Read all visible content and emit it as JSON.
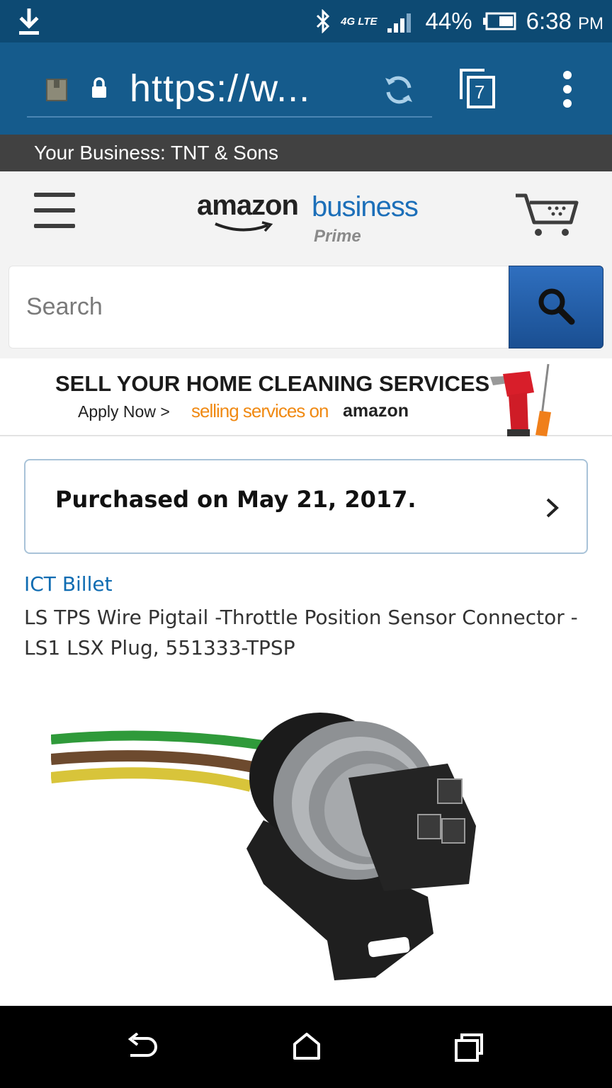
{
  "status_bar": {
    "network": "4G LTE",
    "battery": "44%",
    "time": "6:38",
    "time_suffix": "PM"
  },
  "browser": {
    "url": "https://w...",
    "tab_count": "7"
  },
  "business_bar": {
    "text": "Your Business: TNT & Sons"
  },
  "header": {
    "logo_primary": "amazon",
    "logo_secondary": "business",
    "logo_tier": "Prime"
  },
  "search": {
    "placeholder": "Search"
  },
  "banner": {
    "headline": "SELL YOUR HOME CLEANING SERVICES",
    "apply": "Apply Now >",
    "selling": "selling services on",
    "brand": "amazon"
  },
  "order": {
    "purchased_text": "Purchased on May 21, 2017."
  },
  "product": {
    "brand": "ICT Billet",
    "title": "LS TPS Wire Pigtail -Throttle Position Sensor Connector - LS1 LSX Plug, 551333-TPSP"
  },
  "colors": {
    "status_bar": "#0d4a73",
    "toolbar": "#155b8c",
    "business_bar": "#414141",
    "link": "#0f6cb2",
    "search_button": "#1a4f92",
    "accent_orange": "#f08a14"
  }
}
